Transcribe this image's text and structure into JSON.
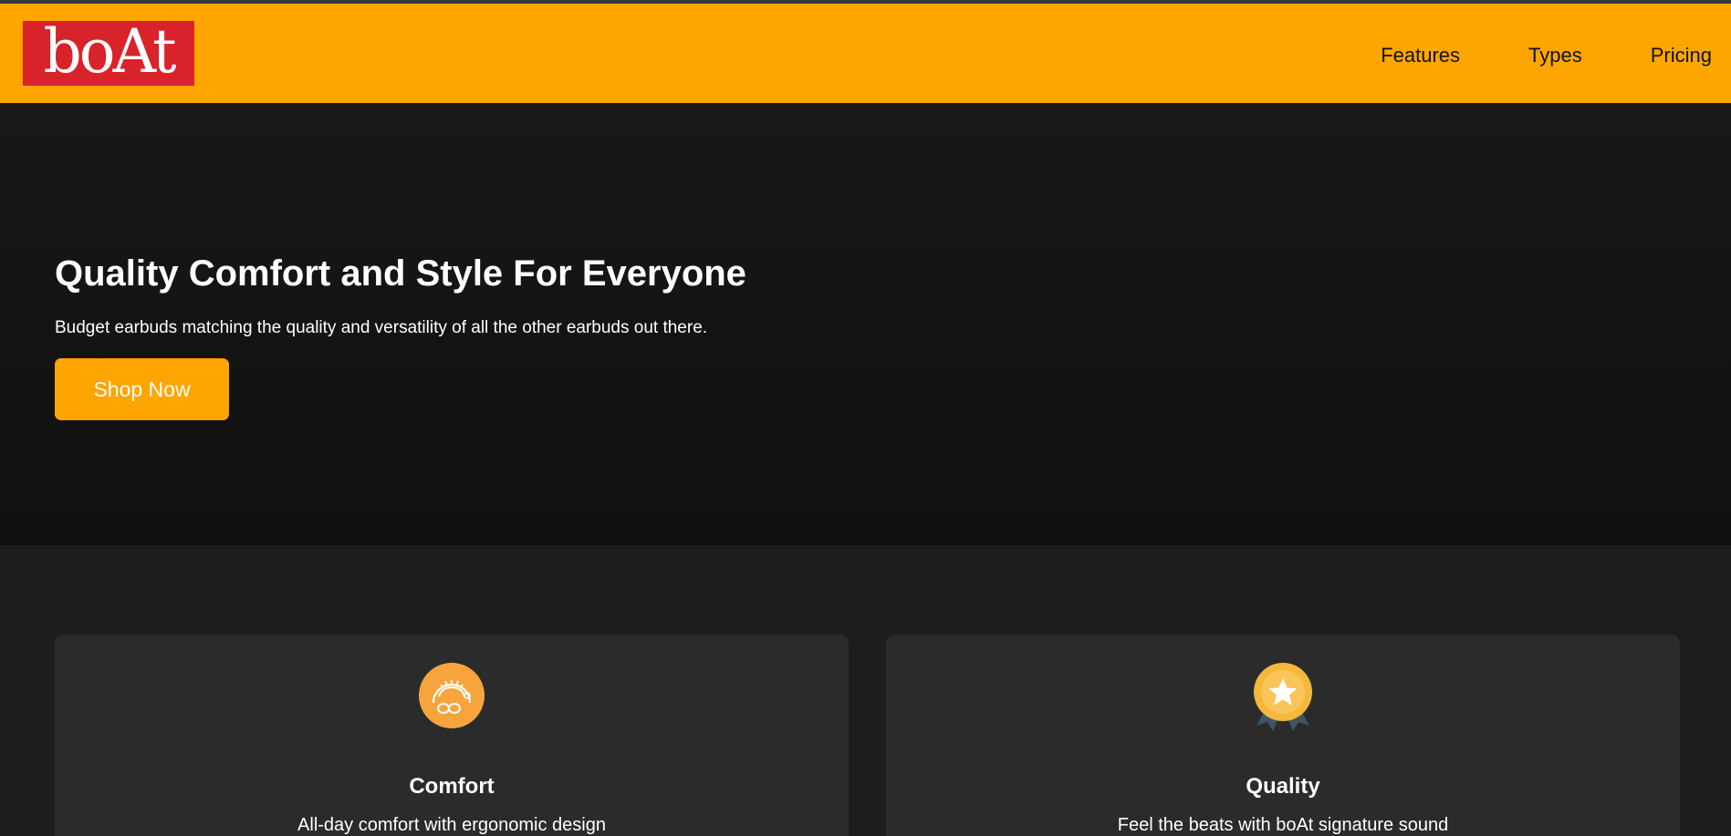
{
  "brand": {
    "logo_text": "boAt",
    "logo_bg": "#d8232a"
  },
  "nav": {
    "bg_color": "#ffa500",
    "links": [
      {
        "label": "Features"
      },
      {
        "label": "Types"
      },
      {
        "label": "Pricing"
      }
    ]
  },
  "hero": {
    "title": "Quality Comfort and Style For Everyone",
    "subtitle": "Budget earbuds matching the quality and versatility of all the other earbuds out there.",
    "cta_label": "Shop Now",
    "cta_color": "#ffa500"
  },
  "features": {
    "cards": [
      {
        "icon": "comfort-earbuds-icon",
        "title": "Comfort",
        "description": "All-day comfort with ergonomic design"
      },
      {
        "icon": "quality-medal-icon",
        "title": "Quality",
        "description": "Feel the beats with boAt signature sound"
      }
    ]
  }
}
